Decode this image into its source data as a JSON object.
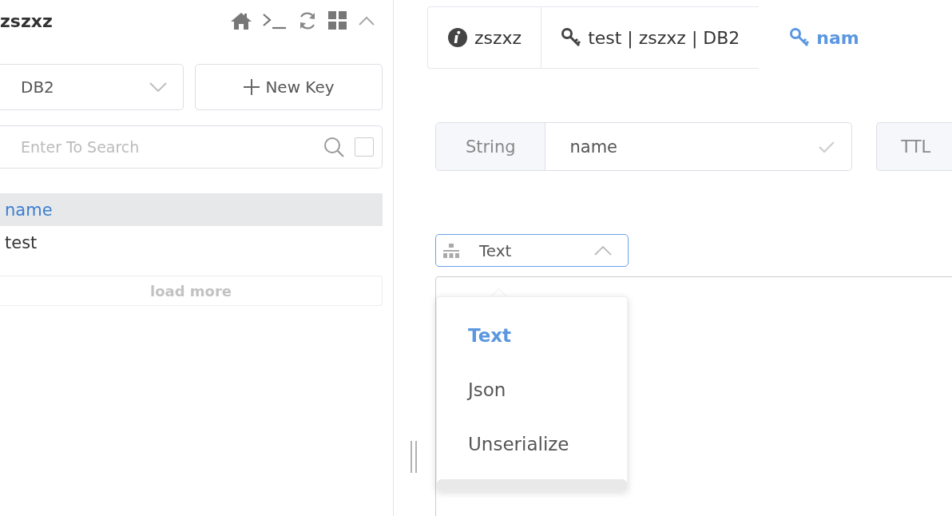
{
  "sidebar": {
    "title": "zszxz",
    "db_select": {
      "value": "DB2"
    },
    "new_key_button": "New Key",
    "search": {
      "placeholder": "Enter To Search",
      "checked": false
    },
    "keys": [
      {
        "label": "name",
        "selected": true
      },
      {
        "label": "test",
        "selected": false
      }
    ],
    "load_more": "load more"
  },
  "tabs": [
    {
      "label": "zszxz",
      "kind": "info",
      "selected": false
    },
    {
      "label": "test | zszxz | DB2",
      "kind": "key",
      "selected": false
    },
    {
      "label": "nam",
      "kind": "key",
      "selected": true
    }
  ],
  "key_row": {
    "type": "String",
    "name": "name",
    "ttl_label": "TTL"
  },
  "format_select": {
    "value": "Text",
    "expanded": true
  },
  "format_options": [
    {
      "label": "Text",
      "selected": true
    },
    {
      "label": "Json",
      "selected": false
    },
    {
      "label": "Unserialize",
      "selected": false
    }
  ]
}
